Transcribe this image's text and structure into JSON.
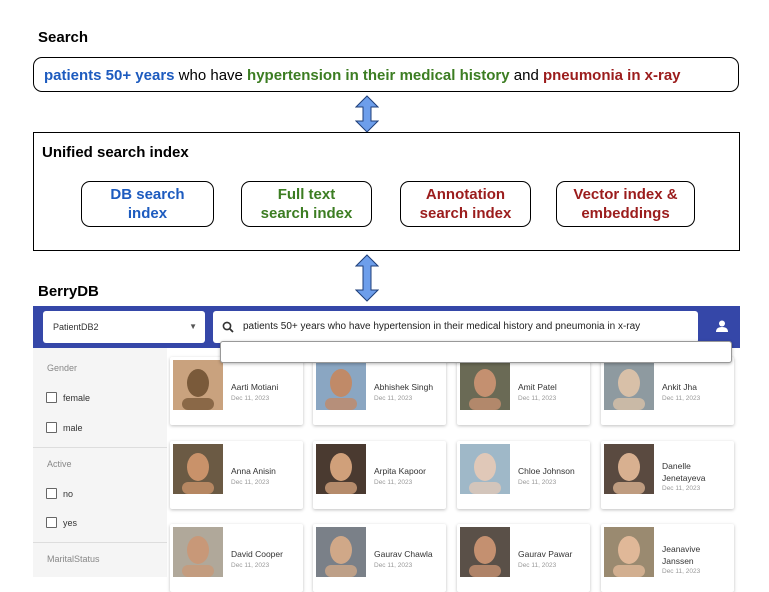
{
  "search": {
    "title": "Search",
    "query": {
      "part1": "patients 50+ years",
      "part2": " who have ",
      "part3": "hypertension in their medical history",
      "part4": " and ",
      "part5": "pneumonia in x-ray"
    }
  },
  "index": {
    "title": "Unified search index",
    "boxes": [
      {
        "line1": "DB search",
        "line2": "index",
        "color": "#1d5bbf"
      },
      {
        "line1": "Full text",
        "line2": "search index",
        "color": "#3c7d22"
      },
      {
        "line1": "Annotation",
        "line2": "search index",
        "color": "#9b1c1c"
      },
      {
        "line1": "Vector index &",
        "line2": "embeddings",
        "color": "#9b1c1c"
      }
    ]
  },
  "berrydb": {
    "title": "BerryDB",
    "db_select": "PatientDB2",
    "search_text": "patients 50+ years who have hypertension in their medical history and pneumonia in x-ray",
    "filters": [
      {
        "head": "Gender",
        "options": [
          "female",
          "male"
        ]
      },
      {
        "head": "Active",
        "options": [
          "no",
          "yes"
        ]
      },
      {
        "head": "MaritalStatus",
        "options": []
      }
    ],
    "cards": [
      {
        "name": "Aarti Motiani",
        "date": "Dec 11, 2023"
      },
      {
        "name": "Abhishek Singh",
        "date": "Dec 11, 2023"
      },
      {
        "name": "Amit Patel",
        "date": "Dec 11, 2023"
      },
      {
        "name": "Ankit Jha",
        "date": "Dec 11, 2023"
      },
      {
        "name": "Anna Anisin",
        "date": "Dec 11, 2023"
      },
      {
        "name": "Arpita Kapoor",
        "date": "Dec 11, 2023"
      },
      {
        "name": "Chloe Johnson",
        "date": "Dec 11, 2023"
      },
      {
        "name": "Danelle Jenetayeva",
        "date": "Dec 11, 2023"
      },
      {
        "name": "David Cooper",
        "date": "Dec 11, 2023"
      },
      {
        "name": "Gaurav Chawla",
        "date": "Dec 11, 2023"
      },
      {
        "name": "Gaurav Pawar",
        "date": "Dec 11, 2023"
      },
      {
        "name": "Jeanavive Janssen",
        "date": "Dec 11, 2023"
      }
    ],
    "colors": {
      "appbar": "#3547a8",
      "arrow": "#6d9eeb"
    }
  }
}
